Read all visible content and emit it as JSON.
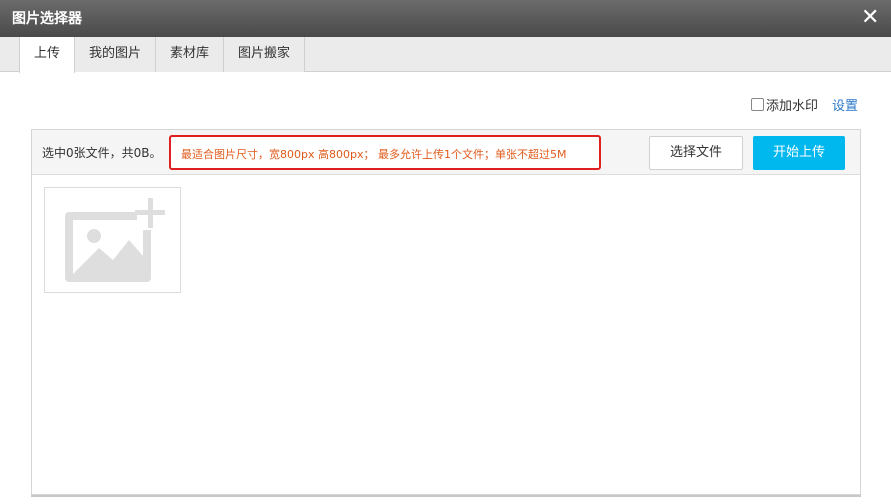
{
  "window": {
    "title": "图片选择器",
    "close_icon": "close-icon"
  },
  "tabs": [
    {
      "label": "上传",
      "active": true
    },
    {
      "label": "我的图片",
      "active": false
    },
    {
      "label": "素材库",
      "active": false
    },
    {
      "label": "图片搬家",
      "active": false
    }
  ],
  "watermark": {
    "label": "添加水印",
    "checked": false,
    "settings_label": "设置"
  },
  "uploader": {
    "status": "选中0张文件，共0B。",
    "hint": "最适合图片尺寸，宽800px 高800px； 最多允许上传1个文件；单张不超过5M",
    "choose_label": "选择文件",
    "start_label": "开始上传",
    "placeholder_icon": "add-image-icon"
  },
  "colors": {
    "accent": "#00b7ee",
    "hint": "#e05a1a",
    "highlight_border": "#e02020",
    "link": "#2b78c9"
  }
}
